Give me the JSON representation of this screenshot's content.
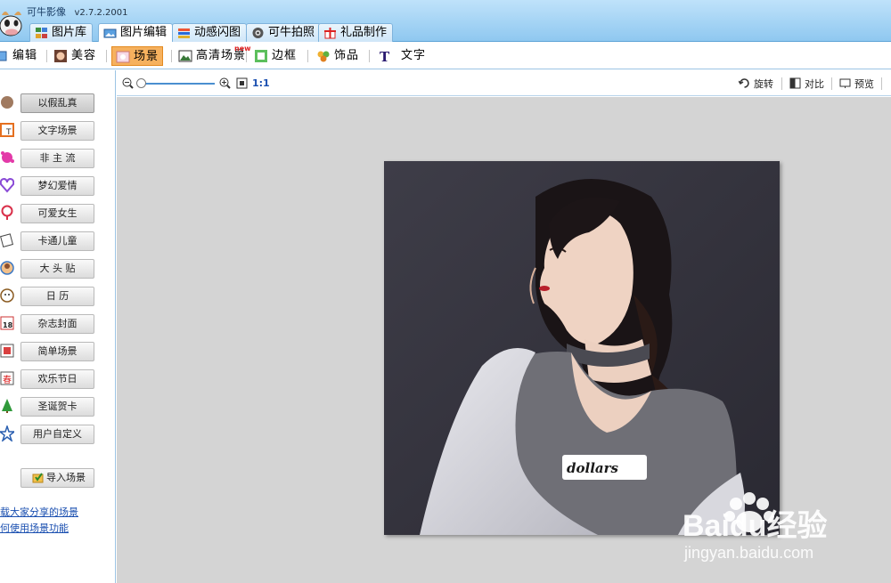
{
  "app": {
    "title": "可牛影像",
    "version": "v2.7.2.2001"
  },
  "tabs": [
    {
      "label": "图片库",
      "icon": "gallery-icon"
    },
    {
      "label": "图片编辑",
      "icon": "edit-photo-icon",
      "active": true
    },
    {
      "label": "动感闪图",
      "icon": "flash-gif-icon"
    },
    {
      "label": "可牛拍照",
      "icon": "camera-icon"
    },
    {
      "label": "礼品制作",
      "icon": "gift-icon"
    }
  ],
  "toolbar": [
    {
      "label": "编辑",
      "icon": "edit-icon"
    },
    {
      "label": "美容",
      "icon": "beauty-icon"
    },
    {
      "label": "场景",
      "icon": "scene-icon",
      "active": true
    },
    {
      "label": "高清场景",
      "icon": "hd-scene-icon"
    },
    {
      "label": "边框",
      "icon": "frame-icon"
    },
    {
      "label": "饰品",
      "icon": "accessory-icon"
    },
    {
      "label": "文字",
      "icon": "text-icon"
    }
  ],
  "hot_badge": "new",
  "scenes": [
    {
      "label": "以假乱真",
      "selected": true
    },
    {
      "label": "文字场景"
    },
    {
      "label": "非 主 流"
    },
    {
      "label": "梦幻爱情"
    },
    {
      "label": "可爱女生"
    },
    {
      "label": "卡通儿童"
    },
    {
      "label": "大 头 贴"
    },
    {
      "label": "日  历"
    },
    {
      "label": "杂志封面"
    },
    {
      "label": "简单场景"
    },
    {
      "label": "欢乐节日"
    },
    {
      "label": "圣诞贺卡"
    },
    {
      "label": "用户自定义"
    }
  ],
  "import_button": "导入场景",
  "links": [
    "载大家分享的场景",
    "何使用场景功能"
  ],
  "viewtools": {
    "ratio": "1:1",
    "rotate": "旋转",
    "compare": "对比",
    "preview": "预览"
  },
  "photo": {
    "shirt_text": "dollars"
  },
  "watermark": {
    "brand": "Baidu经验",
    "url": "jingyan.baidu.com"
  },
  "colors": {
    "accent_active": "#f6b15e",
    "title_bg": "#8fc8f0",
    "canvas_bg": "#d4d4d4",
    "link": "#1a4fb0"
  }
}
